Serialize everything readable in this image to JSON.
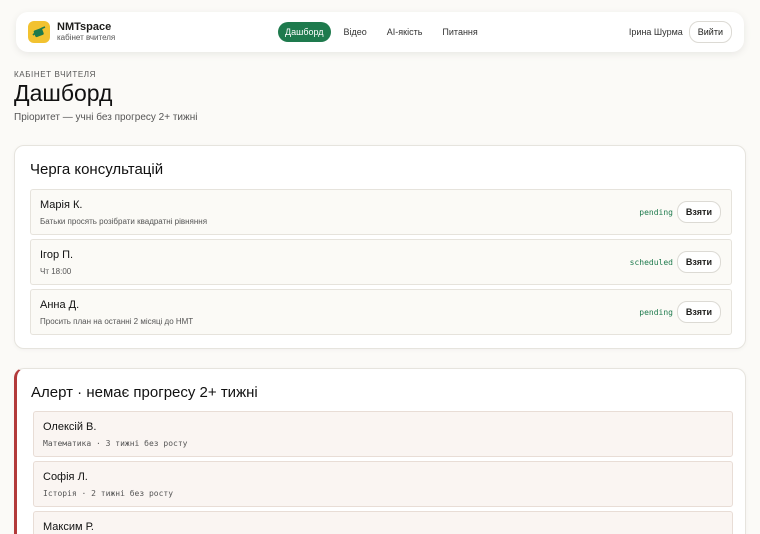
{
  "header": {
    "brand_name": "NMTspace",
    "brand_sub": "кабінет вчителя",
    "nav": [
      "Дашборд",
      "Відео",
      "AI-якість",
      "Питання"
    ],
    "user_name": "Ірина Шурма",
    "logout_label": "Вийти"
  },
  "page": {
    "eyebrow": "КАБІНЕТ ВЧИТЕЛЯ",
    "title": "Дашборд",
    "subtitle": "Пріоритет — учні без прогресу 2+ тижні"
  },
  "queue": {
    "title": "Черга консультацій",
    "take_label": "Взяти",
    "items": [
      {
        "name": "Марія К.",
        "desc": "Батьки просять розібрати квадратні рівняння",
        "status": "pending"
      },
      {
        "name": "Ігор П.",
        "desc": "Чт 18:00",
        "status": "scheduled"
      },
      {
        "name": "Анна Д.",
        "desc": "Просить план на останні 2 місяці до НМТ",
        "status": "pending"
      }
    ]
  },
  "alert": {
    "title": "Алерт · немає прогресу 2+ тижні",
    "items": [
      {
        "name": "Олексій В.",
        "desc": "Математика · 3 тижні без росту"
      },
      {
        "name": "Софія Л.",
        "desc": "Історія · 2 тижні без росту"
      },
      {
        "name": "Максим Р.",
        "desc": ""
      }
    ]
  },
  "colors": {
    "accent": "#1e7a4d",
    "alert": "#b23a3a",
    "logo": "#f2c230"
  }
}
